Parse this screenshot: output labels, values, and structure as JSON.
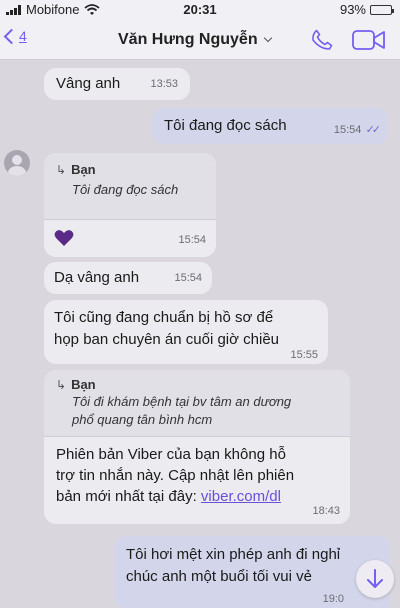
{
  "status_bar": {
    "carrier": "Mobifone",
    "time": "20:31",
    "battery": "93%",
    "battery_level": 0.93
  },
  "header": {
    "back_count": "4",
    "contact_name": "Văn Hưng Nguyễn"
  },
  "messages": [
    {
      "text": "Vâng anh",
      "time": "13:53"
    },
    {
      "text": "Tôi đang đọc sách",
      "time": "15:54"
    },
    {
      "reply_to": "Bạn",
      "quoted": "Tôi đang đọc sách",
      "time": "15:54"
    },
    {
      "text": "Dạ vâng anh",
      "time": "15:54"
    },
    {
      "line1": "Tôi cũng đang chuẩn bị hồ sơ để",
      "line2": "họp ban chuyên án cuối giờ chiều",
      "time": "15:55"
    },
    {
      "reply_to": "Bạn",
      "quoted_line1": "Tôi đi khám bệnh tại bv tâm an dương",
      "quoted_line2": "phổ quang tân bình hcm",
      "line1": "Phiên bản Viber của bạn không hỗ",
      "line2": "trợ tin nhắn này. Cập nhật lên phiên",
      "line3": "bản mới nhất tại đây:",
      "link": "viber.com/dl",
      "time": "18:43"
    },
    {
      "line1": "Tôi hơi mệt xin phép anh đi nghỉ",
      "line2": "chúc anh một buổi tối vui vẻ",
      "time": "19:0"
    }
  ],
  "colors": {
    "accent": "#7360f2",
    "heart": "#5b2a86",
    "outgoing": "#d3d6ea",
    "incoming": "#ecebef"
  },
  "icons": [
    "signal-icon",
    "wifi-icon",
    "battery-icon",
    "back-chevron-icon",
    "chevron-down-icon",
    "phone-icon",
    "video-call-icon",
    "reply-arrow-icon",
    "heart-icon",
    "read-ticks-icon",
    "scroll-down-icon"
  ]
}
